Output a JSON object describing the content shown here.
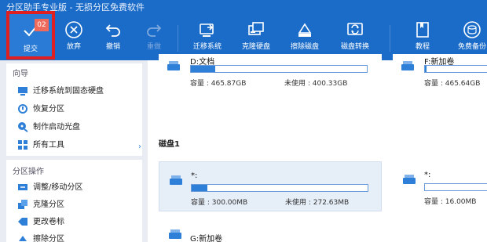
{
  "window": {
    "title": "分区助手专业版 - 无损分区免费软件"
  },
  "toolbar": {
    "submit": {
      "label": "提交",
      "badge": "02"
    },
    "discard": {
      "label": "放弃"
    },
    "undo": {
      "label": "撤销"
    },
    "redo": {
      "label": "重做"
    },
    "migrate": {
      "label": "迁移系统"
    },
    "clone_disk": {
      "label": "克隆硬盘"
    },
    "wipe_disk": {
      "label": "擦除磁盘"
    },
    "disk_convert": {
      "label": "磁盘转换"
    },
    "tutorial": {
      "label": "教程"
    },
    "free_upgrade": {
      "label": "免费备份"
    }
  },
  "sidebar": {
    "wizard_title": "向导",
    "wizard_items": [
      {
        "label": "迁移系统到固态硬盘",
        "icon": "migrate-ssd-icon"
      },
      {
        "label": "恢复分区",
        "icon": "recover-partition-icon"
      },
      {
        "label": "制作启动光盘",
        "icon": "bootable-disc-icon"
      },
      {
        "label": "所有工具",
        "icon": "all-tools-icon"
      }
    ],
    "ops_title": "分区操作",
    "ops_items": [
      {
        "label": "调整/移动分区",
        "icon": "resize-icon"
      },
      {
        "label": "克隆分区",
        "icon": "clone-partition-icon"
      },
      {
        "label": "更改卷标",
        "icon": "label-icon"
      },
      {
        "label": "擦除分区",
        "icon": "wipe-partition-icon"
      }
    ]
  },
  "disks": {
    "disk0": {
      "partitions": [
        {
          "name": "D:文档",
          "capacity_label": "容量 : 465.87GB",
          "unused_label": "未使用 : 400.33GB",
          "used_fraction": 0.14
        },
        {
          "name": "F:新加卷",
          "capacity_label": "容量 : 465.64GB",
          "used_fraction": 0.02
        }
      ]
    },
    "disk1": {
      "label": "磁盘1",
      "partitions": [
        {
          "name": "*:",
          "capacity_label": "容量 : 300.00MB",
          "unused_label": "未使用 : 272.63MB",
          "used_fraction": 0.09
        },
        {
          "name": "*:",
          "capacity_label": "容量 : 16.00MB",
          "used_fraction": 0.0
        },
        {
          "name": "G:新加卷"
        }
      ]
    }
  },
  "colors": {
    "toolbar_bg": "#1b6cc8",
    "accent": "#2d7fd8",
    "highlight_border": "#e02020",
    "badge": "#f06a5c"
  }
}
